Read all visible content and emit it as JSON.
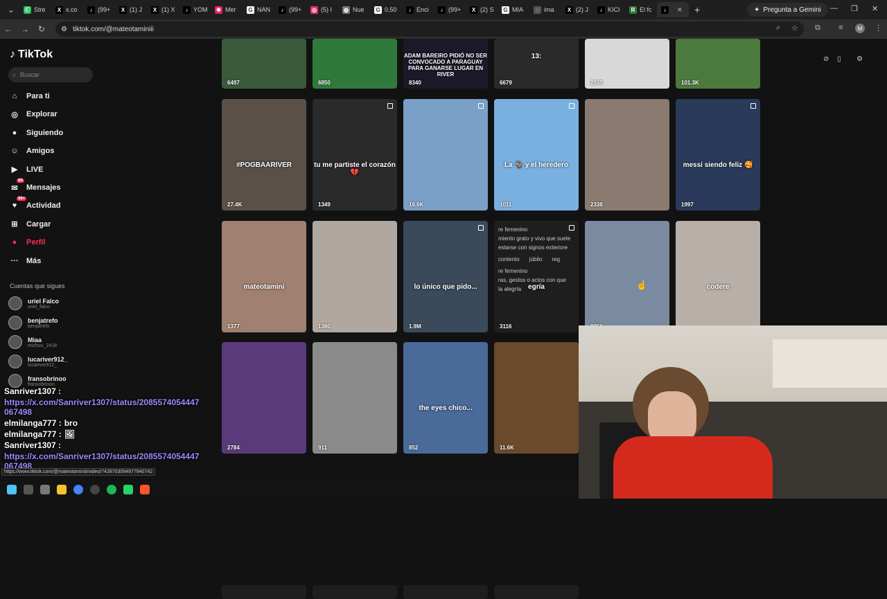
{
  "browser": {
    "tabs": [
      {
        "icon": "Ⓒ",
        "color": "#1db954",
        "label": "Stre"
      },
      {
        "icon": "X",
        "color": "#000000",
        "label": "x.co"
      },
      {
        "icon": "♪",
        "color": "#000000",
        "label": "(99+"
      },
      {
        "icon": "X",
        "color": "#000000",
        "label": "(1) J"
      },
      {
        "icon": "X",
        "color": "#000000",
        "label": "(1) X"
      },
      {
        "icon": "♪",
        "color": "#000000",
        "label": "YOM"
      },
      {
        "icon": "✱",
        "color": "#e91e63",
        "label": "Mer"
      },
      {
        "icon": "G",
        "color": "#ffffff",
        "label": "NAN"
      },
      {
        "icon": "♪",
        "color": "#000000",
        "label": "(99+"
      },
      {
        "icon": "◎",
        "color": "#e1306c",
        "label": "(5) I"
      },
      {
        "icon": "◍",
        "color": "#777777",
        "label": "Nue"
      },
      {
        "icon": "G",
        "color": "#ffffff",
        "label": "0,50"
      },
      {
        "icon": "♪",
        "color": "#000000",
        "label": "Enci"
      },
      {
        "icon": "♪",
        "color": "#000000",
        "label": "(99+"
      },
      {
        "icon": "X",
        "color": "#000000",
        "label": "(2) S"
      },
      {
        "icon": "G",
        "color": "#ffffff",
        "label": "MIA"
      },
      {
        "icon": "◌",
        "color": "#555555",
        "label": "ima"
      },
      {
        "icon": "X",
        "color": "#000000",
        "label": "(2) J"
      },
      {
        "icon": "♪",
        "color": "#000000",
        "label": "KICI"
      },
      {
        "icon": "R",
        "color": "#2e7d32",
        "label": "El fc"
      },
      {
        "icon": "♪",
        "color": "#000000",
        "label": ""
      }
    ],
    "new_tab": "+",
    "gemini_label": "Pregunta a Gemini",
    "url": "tiktok.com/@mateotaminiii"
  },
  "sidebar": {
    "logo": "TikTok",
    "search_placeholder": "Buscar",
    "items": [
      {
        "icon": "⌂",
        "label": "Para ti"
      },
      {
        "icon": "◎",
        "label": "Explorar"
      },
      {
        "icon": "●",
        "label": "Siguiendo"
      },
      {
        "icon": "☺",
        "label": "Amigos"
      },
      {
        "icon": "▶",
        "label": "LIVE"
      },
      {
        "icon": "✉",
        "label": "Mensajes",
        "badge": "99"
      },
      {
        "icon": "♥",
        "label": "Actividad",
        "badge": "99+"
      },
      {
        "icon": "⊞",
        "label": "Cargar"
      },
      {
        "icon": "●",
        "label": "Perfil"
      },
      {
        "icon": "···",
        "label": "Más"
      }
    ],
    "follows_title": "Cuentas que sigues",
    "follows": [
      {
        "name": "uriel Falco",
        "handle": "uriel_falco"
      },
      {
        "name": "benjatrefo",
        "handle": "benjatrefo"
      },
      {
        "name": "Miaa",
        "handle": "michuu_2418"
      },
      {
        "name": "lucariver912_",
        "handle": "lucariver912_"
      },
      {
        "name": "fransobrinoo",
        "handle": "fransobrinoo"
      }
    ]
  },
  "videos": [
    {
      "views": "6497",
      "bg": "#3a5a3a",
      "caption": ""
    },
    {
      "views": "6850",
      "bg": "#2f7a3a",
      "caption": ""
    },
    {
      "views": "8340",
      "bg": "#1a1a2a",
      "caption": "ADAM BAREIRO PIDIÓ NO SER CONVOCADO A PARAGUAY PARA GANARSE LUGAR EN RIVER"
    },
    {
      "views": "6679",
      "bg": "#2a2a2a",
      "caption": "13:"
    },
    {
      "views": "2135",
      "bg": "#d8d8d8",
      "caption": ""
    },
    {
      "views": "101.3K",
      "bg": "#4c7a3c",
      "caption": ""
    },
    {
      "views": "27.4K",
      "bg": "#5a5048",
      "caption": "#POGBAARIVER"
    },
    {
      "views": "1349",
      "bg": "#2a2a2a",
      "caption": "tu me partiste el corazón 💔"
    },
    {
      "views": "16.6K",
      "bg": "#7aa0c8",
      "caption": ""
    },
    {
      "views": "1011",
      "bg": "#7ab0e0",
      "caption": "La 🐐 y el heredero"
    },
    {
      "views": "2338",
      "bg": "#8a7a70",
      "caption": ""
    },
    {
      "views": "1997",
      "bg": "#2a3a5a",
      "caption": "messi siendo feliz 🥰"
    },
    {
      "views": "1377",
      "bg": "#a08070",
      "caption": "mateotamini"
    },
    {
      "views": "1380",
      "bg": "#b0a8a0",
      "caption": ""
    },
    {
      "views": "1.9M",
      "bg": "#3a4a5a",
      "caption": "lo único que pido..."
    },
    {
      "views": "3116",
      "bg": "#1e1e1e",
      "caption": "egría"
    },
    {
      "views": "2951",
      "bg": "#7a8aa0",
      "caption": ""
    },
    {
      "views": "",
      "bg": "#b8b0a8",
      "caption": "codere"
    },
    {
      "views": "2784",
      "bg": "#5a3a7a",
      "caption": ""
    },
    {
      "views": "911",
      "bg": "#8a8a8a",
      "caption": ""
    },
    {
      "views": "852",
      "bg": "#4a6a9a",
      "caption": "the eyes chico..."
    },
    {
      "views": "11.6K",
      "bg": "#6a4a2a",
      "caption": ""
    }
  ],
  "definition_text": {
    "line1": "re femenino",
    "line2": "miento grato y vivo que suele",
    "line3": "estarse con signos exteriore",
    "chips": [
      "contento",
      "júbilo",
      "reg"
    ],
    "line4": "re femenino",
    "line5": "ras, gestos o actos con que",
    "line6": "la alegría"
  },
  "chat": [
    {
      "user": "Sanriver1307 :",
      "text": ""
    },
    {
      "user": "",
      "text": "https://x.com/Sanriver1307/status/2085574054447067498",
      "link": true
    },
    {
      "user": "elmilanga777 :",
      "text": "bro"
    },
    {
      "user": "elmilanga777 :",
      "text": "🖼"
    },
    {
      "user": "Sanriver1307 :",
      "text": ""
    },
    {
      "user": "",
      "text": "https://x.com/Sanriver1307/status/2085574054447067498",
      "link": true
    }
  ],
  "status_url": "https://www.tiktok.com/@mateotaminiii/video/7428703094977940742",
  "colors": {
    "accent": "#fe2c55",
    "bg": "#121212"
  }
}
